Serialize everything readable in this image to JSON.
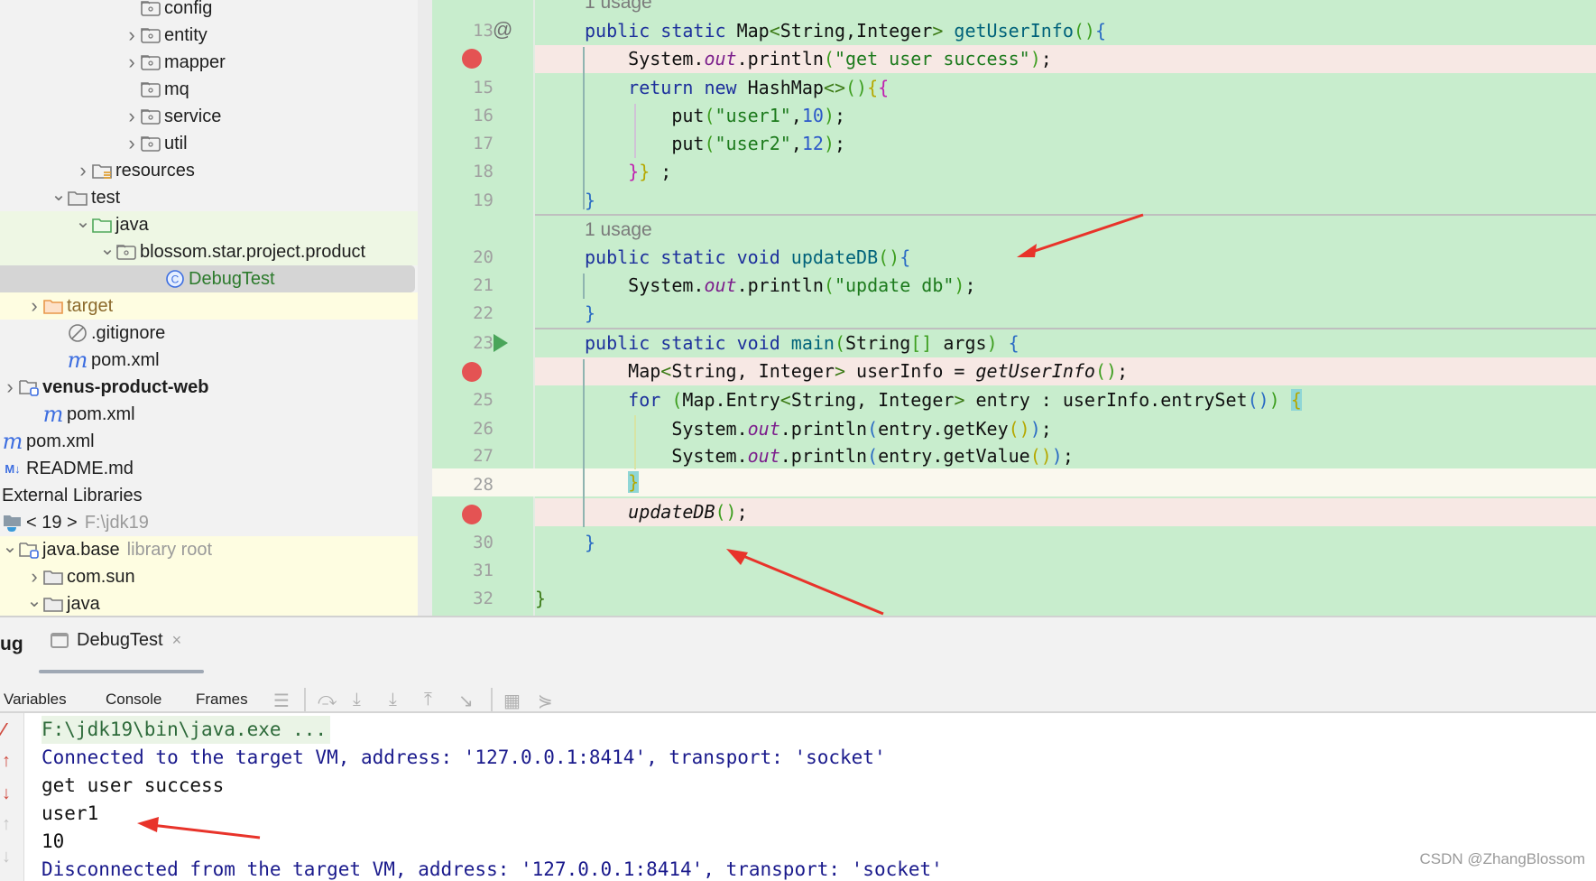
{
  "project_tree": {
    "items": [
      {
        "label": "config",
        "icon": "package-folder-icon",
        "chevron": "",
        "indent": 5,
        "highlight": ""
      },
      {
        "label": "entity",
        "icon": "package-folder-icon",
        "chevron": "right",
        "indent": 5,
        "highlight": ""
      },
      {
        "label": "mapper",
        "icon": "package-folder-icon",
        "chevron": "right",
        "indent": 5,
        "highlight": ""
      },
      {
        "label": "mq",
        "icon": "package-folder-icon",
        "chevron": "",
        "indent": 5,
        "highlight": ""
      },
      {
        "label": "service",
        "icon": "package-folder-icon",
        "chevron": "right",
        "indent": 5,
        "highlight": ""
      },
      {
        "label": "util",
        "icon": "package-folder-icon",
        "chevron": "right",
        "indent": 5,
        "highlight": ""
      },
      {
        "label": "resources",
        "icon": "resources-folder-icon",
        "chevron": "right",
        "indent": 3,
        "highlight": ""
      },
      {
        "label": "test",
        "icon": "folder-icon",
        "chevron": "down",
        "indent": 2,
        "highlight": ""
      },
      {
        "label": "java",
        "icon": "test-source-folder-icon",
        "chevron": "down",
        "indent": 3,
        "highlight": "green"
      },
      {
        "label": "blossom.star.project.product",
        "icon": "package-folder-icon",
        "chevron": "down",
        "indent": 4,
        "highlight": "green"
      },
      {
        "label": "DebugTest",
        "icon": "class-icon",
        "chevron": "",
        "indent": 6,
        "highlight": "selected"
      },
      {
        "label": "target",
        "icon": "excluded-folder-icon",
        "chevron": "right",
        "indent": 1,
        "highlight": "yellow"
      },
      {
        "label": ".gitignore",
        "icon": "ignored-file-icon",
        "chevron": "",
        "indent": 2,
        "highlight": ""
      },
      {
        "label": "pom.xml",
        "icon": "maven-icon",
        "chevron": "",
        "indent": 2,
        "highlight": ""
      },
      {
        "label": "venus-product-web",
        "icon": "module-folder-icon",
        "chevron": "right",
        "indent": 0,
        "highlight": "",
        "bold": true
      },
      {
        "label": "pom.xml",
        "icon": "maven-icon",
        "chevron": "",
        "indent": 1,
        "highlight": ""
      },
      {
        "label": "pom.xml",
        "icon": "maven-icon",
        "chevron": "",
        "indent": -1,
        "highlight": ""
      },
      {
        "label": "README.md",
        "icon": "markdown-icon",
        "chevron": "",
        "indent": -1,
        "highlight": ""
      },
      {
        "label": "External Libraries",
        "icon": "",
        "chevron": "",
        "indent": -1,
        "highlight": ""
      },
      {
        "label": "< 19 >",
        "icon": "jdk-icon",
        "chevron": "",
        "indent": -1,
        "highlight": "",
        "suffix": "F:\\jdk19"
      },
      {
        "label": "java.base",
        "icon": "module-folder-icon",
        "chevron": "down",
        "indent": 0,
        "highlight": "yellow",
        "suffix": "library root"
      },
      {
        "label": "com.sun",
        "icon": "folder-icon",
        "chevron": "right",
        "indent": 1,
        "highlight": "yellow"
      },
      {
        "label": "java",
        "icon": "folder-icon",
        "chevron": "down",
        "indent": 1,
        "highlight": "yellow"
      }
    ]
  },
  "editor": {
    "usage_top": "1 usage",
    "usage_mid": "1 usage",
    "line_numbers": {
      "l13": "13",
      "l15": "15",
      "l16": "16",
      "l17": "17",
      "l18": "18",
      "l19": "19",
      "l20": "20",
      "l21": "21",
      "l22": "22",
      "l23": "23",
      "l25": "25",
      "l26": "26",
      "l27": "27",
      "l28": "28",
      "l30": "30",
      "l31": "31",
      "l32": "32"
    },
    "code": {
      "l13": {
        "kw1": "public static ",
        "t1": "Map",
        "g1": "<",
        "t2": "String,Integer",
        "g2": ">",
        "sp": " ",
        "fn": "getUserInfo",
        "p": "()",
        "b": "{"
      },
      "l14": {
        "a": "System.",
        "fld": "out",
        "b": ".println",
        "p1": "(",
        "s": "\"get user success\"",
        "p2": ")",
        "e": ";"
      },
      "l15": {
        "kw": "return new ",
        "a": "HashMap",
        "g": "<>",
        "p": "()",
        "b1": "{",
        "b2": "{"
      },
      "l16": {
        "a": "put",
        "p1": "(",
        "s": "\"user1\"",
        "c": ",",
        "n": "10",
        "p2": ")",
        "e": ";"
      },
      "l17": {
        "a": "put",
        "p1": "(",
        "s": "\"user2\"",
        "c": ",",
        "n": "12",
        "p2": ")",
        "e": ";"
      },
      "l18": {
        "b1": "}",
        "b2": "}",
        "e": " ;"
      },
      "l19": {
        "b": "}"
      },
      "l20": {
        "kw": "public static void ",
        "fn": "updateDB",
        "p": "()",
        "b": "{"
      },
      "l21": {
        "a": "System.",
        "fld": "out",
        "b": ".println",
        "p1": "(",
        "s": "\"update db\"",
        "p2": ")",
        "e": ";"
      },
      "l22": {
        "b": "}"
      },
      "l23": {
        "kw": "public static void ",
        "fn": "main",
        "p1": "(",
        "a": "String",
        "br": "[]",
        "args": " args",
        "p2": ")",
        "sp": " ",
        "b": "{"
      },
      "l24": {
        "a": "Map",
        "g1": "<",
        "t": "String, Integer",
        "g2": ">",
        "v": " userInfo = ",
        "it": "getUserInfo",
        "p": "()",
        "e": ";"
      },
      "l25": {
        "kw": "for ",
        "p1": "(",
        "a": "Map.Entry",
        "g1": "<",
        "t": "String, Integer",
        "g2": ">",
        "v": " entry : userInfo.entrySet",
        "p2": "()",
        "p3": ")",
        "sp": " ",
        "b": "{"
      },
      "l26": {
        "a": "System.",
        "fld": "out",
        "b": ".println",
        "p1": "(",
        "v": "entry.getKey",
        "p2": "()",
        "p3": ")",
        "e": ";"
      },
      "l27": {
        "a": "System.",
        "fld": "out",
        "b": ".println",
        "p1": "(",
        "v": "entry.getValue",
        "p2": "()",
        "p3": ")",
        "e": ";"
      },
      "l28": {
        "b": "}"
      },
      "l29": {
        "it": "updateDB",
        "p": "()",
        "e": ";"
      },
      "l30": {
        "b": "}"
      },
      "l32": {
        "b": "}"
      }
    }
  },
  "debug": {
    "title": "ug",
    "session_tab": "DebugTest",
    "close_glyph": "×",
    "subtabs": [
      "Variables",
      "Console",
      "Frames"
    ],
    "active_subtab": "Console",
    "console_lines": [
      {
        "text": "F:\\jdk19\\bin\\java.exe ...",
        "kind": "cmd"
      },
      {
        "text": "Connected to the target VM, address: '127.0.0.1:8414', transport: 'socket'",
        "kind": "sys"
      },
      {
        "text": "get user success",
        "kind": "out"
      },
      {
        "text": "user1",
        "kind": "out"
      },
      {
        "text": "10",
        "kind": "out"
      },
      {
        "text": "Disconnected from the target VM, address: '127.0.0.1:8414', transport: 'socket'",
        "kind": "sys"
      }
    ]
  },
  "watermark": "CSDN @ZhangBlossom",
  "colors": {
    "editor_bg": "#c8edcd",
    "breakpoint": "#e45353",
    "breakpoint_line": "#f7e8e4",
    "run_gutter": "#4aa55a",
    "annotation_arrow": "#e8332a"
  }
}
